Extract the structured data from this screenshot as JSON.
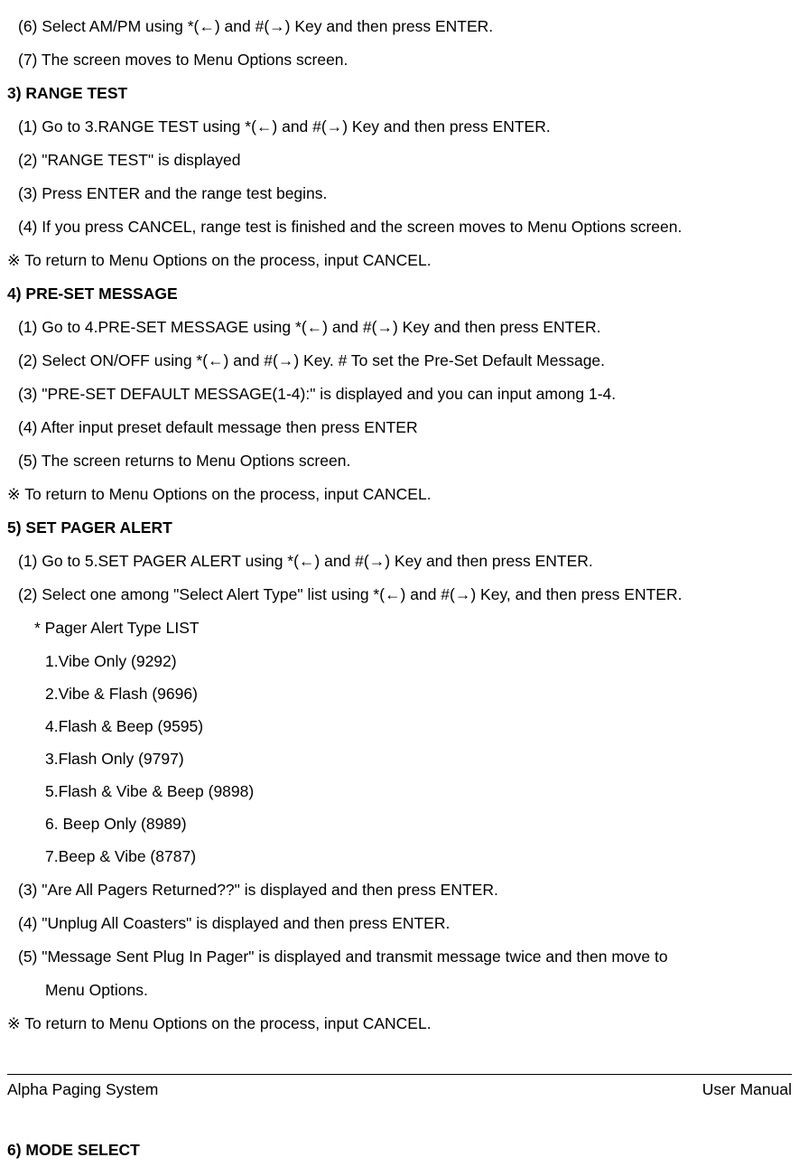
{
  "lines": {
    "l1": "(6) Select AM/PM using *(←) and #(→) Key and then press ENTER.",
    "l2": "(7) The screen moves to Menu Options screen.",
    "h3": "3) RANGE TEST",
    "l3_1": "(1) Go to 3.RANGE TEST using *(←) and #(→) Key and then press ENTER.",
    "l3_2": "(2) \"RANGE TEST\" is displayed",
    "l3_3": "(3) Press ENTER and the range test begins.",
    "l3_4": "(4) If you press CANCEL, range test is finished and the screen moves to Menu Options screen.",
    "n3": "※  To return to Menu Options on the process, input CANCEL.",
    "h4": "4) PRE-SET MESSAGE",
    "l4_1": "(1) Go to 4.PRE-SET MESSAGE using *(←) and #(→) Key and then press ENTER.",
    "l4_2": "(2) Select ON/OFF using *(←) and #(→) Key. # To set the Pre-Set Default Message.",
    "l4_3": "(3) \"PRE-SET DEFAULT MESSAGE(1-4):\" is displayed and you can input among 1-4.",
    "l4_4": "(4) After input preset default message then press ENTER",
    "l4_5": "(5) The screen returns to Menu Options screen.",
    "n4": "※  To return to Menu Options on the process, input CANCEL.",
    "h5": "5) SET PAGER ALERT",
    "l5_1": "(1) Go to 5.SET PAGER ALERT using *(←) and #(→) Key and then press ENTER.",
    "l5_2": "(2) Select one among \"Select Alert Type\" list using *(←) and #(→) Key, and then press ENTER.",
    "l5_listheader": "* Pager Alert Type LIST",
    "l5_li1": "1.Vibe Only (9292)",
    "l5_li2": "2.Vibe & Flash (9696)",
    "l5_li3": "4.Flash & Beep (9595)",
    "l5_li4": "3.Flash Only (9797)",
    "l5_li5": "5.Flash & Vibe & Beep (9898)",
    "l5_li6": "6. Beep Only (8989)",
    "l5_li7": "7.Beep & Vibe (8787)",
    "l5_3": "(3) \"Are All Pagers Returned??\" is displayed and then press ENTER.",
    "l5_4": "(4) \"Unplug All Coasters\" is displayed and then press ENTER.",
    "l5_5a": "(5) \"Message Sent Plug In Pager\" is displayed and transmit message twice and then move to",
    "l5_5b": "Menu Options.",
    "n5": "※  To return to Menu Options on the process, input CANCEL.",
    "footer_left": "Alpha Paging System",
    "footer_right": "User    Manual",
    "h6": "6) MODE SELECT"
  }
}
